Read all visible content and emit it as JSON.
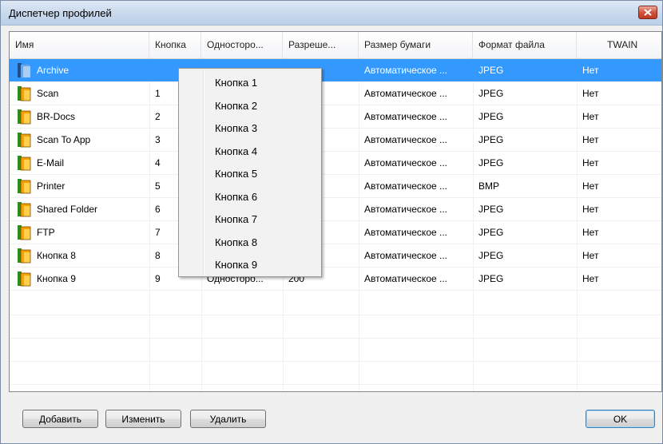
{
  "window": {
    "title": "Диспетчер профилей"
  },
  "list": {
    "columns": [
      "Имя",
      "Кнопка",
      "Односторо...",
      "Разреше...",
      "Размер бумаги",
      "Формат файла",
      "TWAIN"
    ],
    "rows": [
      {
        "name": "Archive",
        "button": "",
        "sides": "",
        "resolution": "",
        "paper": "Автоматическое ...",
        "format": "JPEG",
        "twain": "Нет",
        "selected": true
      },
      {
        "name": "Scan",
        "button": "1",
        "sides": "",
        "resolution": "",
        "paper": "Автоматическое ...",
        "format": "JPEG",
        "twain": "Нет"
      },
      {
        "name": "BR-Docs",
        "button": "2",
        "sides": "",
        "resolution": "",
        "paper": "Автоматическое ...",
        "format": "JPEG",
        "twain": "Нет"
      },
      {
        "name": "Scan To App",
        "button": "3",
        "sides": "",
        "resolution": "",
        "paper": "Автоматическое ...",
        "format": "JPEG",
        "twain": "Нет"
      },
      {
        "name": "E-Mail",
        "button": "4",
        "sides": "",
        "resolution": "",
        "paper": "Автоматическое ...",
        "format": "JPEG",
        "twain": "Нет"
      },
      {
        "name": "Printer",
        "button": "5",
        "sides": "",
        "resolution": "",
        "paper": "Автоматическое ...",
        "format": "BMP",
        "twain": "Нет"
      },
      {
        "name": "Shared Folder",
        "button": "6",
        "sides": "",
        "resolution": "",
        "paper": "Автоматическое ...",
        "format": "JPEG",
        "twain": "Нет"
      },
      {
        "name": "FTP",
        "button": "7",
        "sides": "",
        "resolution": "",
        "paper": "Автоматическое ...",
        "format": "JPEG",
        "twain": "Нет"
      },
      {
        "name": "Кнопка 8",
        "button": "8",
        "sides": "",
        "resolution": "",
        "paper": "Автоматическое ...",
        "format": "JPEG",
        "twain": "Нет"
      },
      {
        "name": "Кнопка 9",
        "button": "9",
        "sides": "Односторо...",
        "resolution": "200",
        "paper": "Автоматическое ...",
        "format": "JPEG",
        "twain": "Нет"
      }
    ]
  },
  "context_menu": {
    "items": [
      "Кнопка 1",
      "Кнопка 2",
      "Кнопка 3",
      "Кнопка 4",
      "Кнопка 5",
      "Кнопка 6",
      "Кнопка 7",
      "Кнопка 8",
      "Кнопка 9"
    ]
  },
  "buttons": {
    "add": "Добавить",
    "edit": "Изменить",
    "delete": "Удалить",
    "ok": "OK"
  },
  "colors": {
    "selection": "#3399ff",
    "folder_orange": "#f5a100",
    "folder_green": "#2e8b1c"
  },
  "icons": {
    "row_icon": "folder-icon",
    "close": "close-icon"
  }
}
